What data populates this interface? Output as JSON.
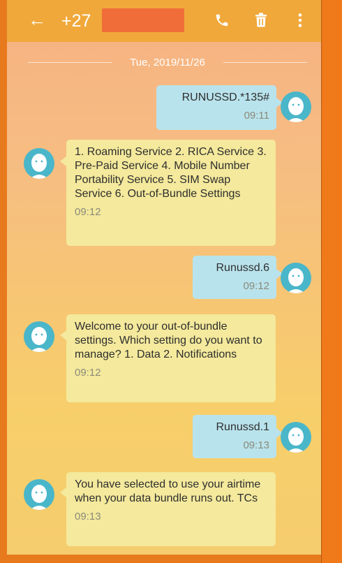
{
  "header": {
    "back_icon": "arrow-left-icon",
    "phone_number": "+27",
    "call_icon": "phone-icon",
    "delete_icon": "trash-icon",
    "menu_icon": "more-vertical-icon",
    "bar_color": "#f0a83a"
  },
  "conversation": {
    "date": "Tue, 2019/11/26",
    "messages": [
      {
        "direction": "out",
        "text": "RUNUSSD.*135#",
        "time": "09:11"
      },
      {
        "direction": "in",
        "text": "1. Roaming Service 2. RICA Service 3. Pre-Paid Service 4. Mobile Number Portability Service 5. SIM Swap Service 6. Out-of-Bundle Settings",
        "time": "09:12"
      },
      {
        "direction": "out",
        "text": "Runussd.6",
        "time": "09:12"
      },
      {
        "direction": "in",
        "text": "Welcome to your out-of-bundle settings. Which setting do you want to manage?  1. Data 2. Notifications",
        "time": "09:12"
      },
      {
        "direction": "out",
        "text": "Runussd.1",
        "time": "09:13"
      },
      {
        "direction": "in",
        "text": "You have selected to use your airtime when your data bundle runs out. TCs",
        "time": "09:13"
      }
    ]
  },
  "colors": {
    "outgoing_bubble": "#b9e3ec",
    "incoming_bubble": "#f4e99c",
    "avatar": "#4ab6c9"
  }
}
